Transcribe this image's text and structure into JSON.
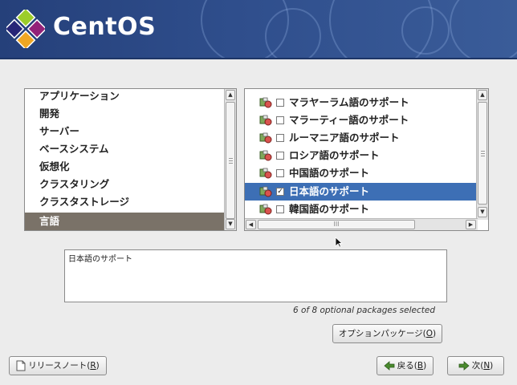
{
  "header": {
    "logo_text": "CentOS",
    "colors": {
      "banner": "#2f4e8c",
      "selection_groups": "#7a7268",
      "selection_packages": "#3d6fb5"
    }
  },
  "groups": {
    "items": [
      {
        "label": "アプリケーション",
        "selected": false
      },
      {
        "label": "開発",
        "selected": false
      },
      {
        "label": "サーバー",
        "selected": false
      },
      {
        "label": "ベースシステム",
        "selected": false
      },
      {
        "label": "仮想化",
        "selected": false
      },
      {
        "label": "クラスタリング",
        "selected": false
      },
      {
        "label": "クラスタストレージ",
        "selected": false
      },
      {
        "label": "言語",
        "selected": true
      }
    ]
  },
  "packages": {
    "items": [
      {
        "label": "マラヤーラム語のサポート",
        "checked": false,
        "selected": false
      },
      {
        "label": "マラーティー語のサポート",
        "checked": false,
        "selected": false
      },
      {
        "label": "ルーマニア語のサポート",
        "checked": false,
        "selected": false
      },
      {
        "label": "ロシア語のサポート",
        "checked": false,
        "selected": false
      },
      {
        "label": "中国語のサポート",
        "checked": false,
        "selected": false
      },
      {
        "label": "日本語のサポート",
        "checked": true,
        "selected": true
      },
      {
        "label": "韓国語のサポート",
        "checked": false,
        "selected": false
      }
    ],
    "scroll_grip": "III"
  },
  "description": {
    "text": "日本語のサポート"
  },
  "status": {
    "text": "6 of 8 optional packages selected"
  },
  "buttons": {
    "optional_packages": {
      "label": "オプションパッケージ(",
      "mnemonic": "O",
      "suffix": ")"
    },
    "release_notes": {
      "label": "リリースノート(",
      "mnemonic": "R",
      "suffix": ")",
      "icon": "document-icon"
    },
    "back": {
      "label": "戻る(",
      "mnemonic": "B",
      "suffix": ")",
      "icon": "left-arrow-icon"
    },
    "next": {
      "label": "次(",
      "mnemonic": "N",
      "suffix": ")",
      "icon": "right-arrow-icon"
    }
  }
}
